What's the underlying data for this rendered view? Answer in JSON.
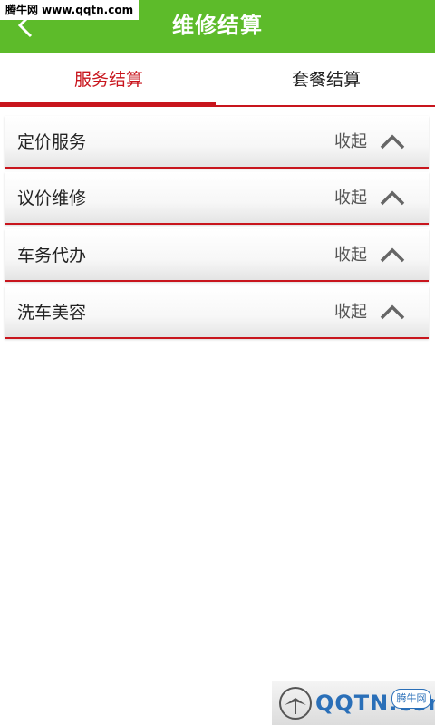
{
  "watermark_top": "腾牛网 www.qqtn.com",
  "header": {
    "title": "维修结算"
  },
  "tabs": [
    {
      "label": "服务结算",
      "active": true
    },
    {
      "label": "套餐结算",
      "active": false
    }
  ],
  "sections": [
    {
      "label": "定价服务",
      "toggle_label": "收起"
    },
    {
      "label": "议价维修",
      "toggle_label": "收起"
    },
    {
      "label": "车务代办",
      "toggle_label": "收起"
    },
    {
      "label": "洗车美容",
      "toggle_label": "收起"
    }
  ],
  "watermark_bottom": {
    "text": "QQTN.com",
    "badge": "腾牛网"
  },
  "colors": {
    "header": "#5dbb2a",
    "accent": "#c8151d"
  }
}
